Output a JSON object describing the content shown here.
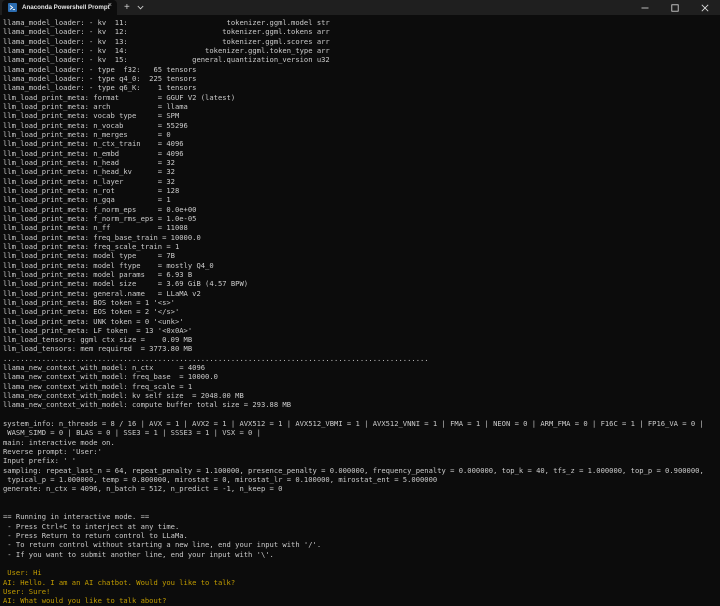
{
  "window": {
    "tab_title": "Anaconda Powershell Prompt",
    "tab_icon": "powershell-icon",
    "new_tab_label": "+",
    "close_tab_label": "×",
    "accent": "#2b6cb0"
  },
  "colors": {
    "background": "#0c0c0c",
    "text": "#cccccc",
    "ai_text": "#c19c00",
    "titlebar": "#1f1f1f"
  },
  "terminal": {
    "lines": [
      {
        "text": "llama_model_loader: - kv  11:                       tokenizer.ggml.model str",
        "style": "normal"
      },
      {
        "text": "llama_model_loader: - kv  12:                      tokenizer.ggml.tokens arr",
        "style": "normal"
      },
      {
        "text": "llama_model_loader: - kv  13:                      tokenizer.ggml.scores arr",
        "style": "normal"
      },
      {
        "text": "llama_model_loader: - kv  14:                  tokenizer.ggml.token_type arr",
        "style": "normal"
      },
      {
        "text": "llama_model_loader: - kv  15:               general.quantization_version u32",
        "style": "normal"
      },
      {
        "text": "llama_model_loader: - type  f32:   65 tensors",
        "style": "normal"
      },
      {
        "text": "llama_model_loader: - type q4_0:  225 tensors",
        "style": "normal"
      },
      {
        "text": "llama_model_loader: - type q6_K:    1 tensors",
        "style": "normal"
      },
      {
        "text": "llm_load_print_meta: format         = GGUF V2 (latest)",
        "style": "normal"
      },
      {
        "text": "llm_load_print_meta: arch           = llama",
        "style": "normal"
      },
      {
        "text": "llm_load_print_meta: vocab type     = SPM",
        "style": "normal"
      },
      {
        "text": "llm_load_print_meta: n_vocab        = 55296",
        "style": "normal"
      },
      {
        "text": "llm_load_print_meta: n_merges       = 0",
        "style": "normal"
      },
      {
        "text": "llm_load_print_meta: n_ctx_train    = 4096",
        "style": "normal"
      },
      {
        "text": "llm_load_print_meta: n_embd         = 4096",
        "style": "normal"
      },
      {
        "text": "llm_load_print_meta: n_head         = 32",
        "style": "normal"
      },
      {
        "text": "llm_load_print_meta: n_head_kv      = 32",
        "style": "normal"
      },
      {
        "text": "llm_load_print_meta: n_layer        = 32",
        "style": "normal"
      },
      {
        "text": "llm_load_print_meta: n_rot          = 128",
        "style": "normal"
      },
      {
        "text": "llm_load_print_meta: n_gqa          = 1",
        "style": "normal"
      },
      {
        "text": "llm_load_print_meta: f_norm_eps     = 0.0e+00",
        "style": "normal"
      },
      {
        "text": "llm_load_print_meta: f_norm_rms_eps = 1.0e-05",
        "style": "normal"
      },
      {
        "text": "llm_load_print_meta: n_ff           = 11008",
        "style": "normal"
      },
      {
        "text": "llm_load_print_meta: freq_base_train = 10000.0",
        "style": "normal"
      },
      {
        "text": "llm_load_print_meta: freq_scale_train = 1",
        "style": "normal"
      },
      {
        "text": "llm_load_print_meta: model type     = 7B",
        "style": "normal"
      },
      {
        "text": "llm_load_print_meta: model ftype    = mostly Q4_0",
        "style": "normal"
      },
      {
        "text": "llm_load_print_meta: model params   = 6.93 B",
        "style": "normal"
      },
      {
        "text": "llm_load_print_meta: model size     = 3.69 GiB (4.57 BPW)",
        "style": "normal"
      },
      {
        "text": "llm_load_print_meta: general.name   = LLaMA v2",
        "style": "normal"
      },
      {
        "text": "llm_load_print_meta: BOS token = 1 '<s>'",
        "style": "normal"
      },
      {
        "text": "llm_load_print_meta: EOS token = 2 '</s>'",
        "style": "normal"
      },
      {
        "text": "llm_load_print_meta: UNK token = 0 '<unk>'",
        "style": "normal"
      },
      {
        "text": "llm_load_print_meta: LF token  = 13 '<0x0A>'",
        "style": "normal"
      },
      {
        "text": "llm_load_tensors: ggml ctx size =    0.09 MB",
        "style": "normal"
      },
      {
        "text": "llm_load_tensors: mem required  = 3773.80 MB",
        "style": "normal"
      },
      {
        "text": "...................................................................................................",
        "style": "normal"
      },
      {
        "text": "llama_new_context_with_model: n_ctx      = 4096",
        "style": "normal"
      },
      {
        "text": "llama_new_context_with_model: freq_base  = 10000.0",
        "style": "normal"
      },
      {
        "text": "llama_new_context_with_model: freq_scale = 1",
        "style": "normal"
      },
      {
        "text": "llama_new_context_with_model: kv self size  = 2048.00 MB",
        "style": "normal"
      },
      {
        "text": "llama_new_context_with_model: compute buffer total size = 293.88 MB",
        "style": "normal"
      },
      {
        "text": "",
        "style": "normal"
      },
      {
        "text": "system_info: n_threads = 8 / 16 | AVX = 1 | AVX2 = 1 | AVX512 = 1 | AVX512_VBMI = 1 | AVX512_VNNI = 1 | FMA = 1 | NEON = 0 | ARM_FMA = 0 | F16C = 1 | FP16_VA = 0 |",
        "style": "normal"
      },
      {
        "text": " WASM_SIMD = 0 | BLAS = 0 | SSE3 = 1 | SSSE3 = 1 | VSX = 0 |",
        "style": "normal"
      },
      {
        "text": "main: interactive mode on.",
        "style": "normal"
      },
      {
        "text": "Reverse prompt: 'User:'",
        "style": "normal"
      },
      {
        "text": "Input prefix: ' '",
        "style": "normal"
      },
      {
        "text": "sampling: repeat_last_n = 64, repeat_penalty = 1.100000, presence_penalty = 0.000000, frequency_penalty = 0.000000, top_k = 40, tfs_z = 1.000000, top_p = 0.900000,",
        "style": "normal"
      },
      {
        "text": " typical_p = 1.000000, temp = 0.800000, mirostat = 0, mirostat_lr = 0.100000, mirostat_ent = 5.000000",
        "style": "normal"
      },
      {
        "text": "generate: n_ctx = 4096, n_batch = 512, n_predict = -1, n_keep = 0",
        "style": "normal"
      },
      {
        "text": "",
        "style": "normal"
      },
      {
        "text": "",
        "style": "normal"
      },
      {
        "text": "== Running in interactive mode. ==",
        "style": "normal"
      },
      {
        "text": " - Press Ctrl+C to interject at any time.",
        "style": "normal"
      },
      {
        "text": " - Press Return to return control to LLaMa.",
        "style": "normal"
      },
      {
        "text": " - To return control without starting a new line, end your input with '/'.",
        "style": "normal"
      },
      {
        "text": " - If you want to submit another line, end your input with '\\'.",
        "style": "normal"
      },
      {
        "text": "",
        "style": "normal"
      },
      {
        "text": " User: Hi",
        "style": "ai"
      },
      {
        "text": "AI: Hello. I am an AI chatbot. Would you like to talk?",
        "style": "ai"
      },
      {
        "text": "User: Sure!",
        "style": "ai"
      },
      {
        "text": "AI: What would you like to talk about?",
        "style": "ai"
      },
      {
        "text": "User:",
        "style": "ai"
      }
    ]
  }
}
